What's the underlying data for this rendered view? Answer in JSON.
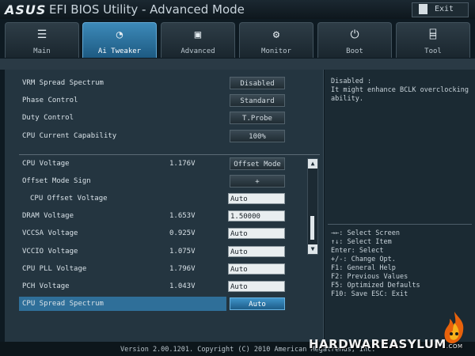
{
  "header": {
    "logo": "ASUS",
    "title": "EFI BIOS Utility - Advanced Mode",
    "exit_label": "Exit"
  },
  "tabs": [
    {
      "label": "Main",
      "icon": "list-icon"
    },
    {
      "label": "Ai Tweaker",
      "icon": "tweaker-icon",
      "active": true
    },
    {
      "label": "Advanced",
      "icon": "advanced-icon"
    },
    {
      "label": "Monitor",
      "icon": "monitor-icon"
    },
    {
      "label": "Boot",
      "icon": "power-icon"
    },
    {
      "label": "Tool",
      "icon": "toolbox-icon"
    }
  ],
  "settings_top": [
    {
      "label": "VRM Spread Spectrum",
      "value": "Disabled"
    },
    {
      "label": "Phase Control",
      "value": "Standard"
    },
    {
      "label": "Duty Control",
      "value": "T.Probe"
    },
    {
      "label": "CPU Current Capability",
      "value": "100%"
    }
  ],
  "settings_bottom": [
    {
      "label": "CPU Voltage",
      "reading": "1.176V",
      "control": "Offset Mode"
    },
    {
      "label": "Offset Mode Sign",
      "reading": "",
      "control": "+"
    },
    {
      "label": "CPU Offset Voltage",
      "reading": "",
      "control": "Auto"
    },
    {
      "label": "DRAM Voltage",
      "reading": "1.653V",
      "control": "1.50000"
    },
    {
      "label": "VCCSA Voltage",
      "reading": "0.925V",
      "control": "Auto"
    },
    {
      "label": "VCCIO Voltage",
      "reading": "1.075V",
      "control": "Auto"
    },
    {
      "label": "CPU PLL Voltage",
      "reading": "1.796V",
      "control": "Auto"
    },
    {
      "label": "PCH Voltage",
      "reading": "1.043V",
      "control": "Auto"
    },
    {
      "label": "CPU Spread Spectrum",
      "reading": "",
      "control": "Auto",
      "selected": true
    }
  ],
  "help": {
    "lines": [
      "Disabled :",
      "It might enhance BCLK overclocking",
      "ability."
    ]
  },
  "keys": {
    "lines": [
      "→←: Select Screen",
      "↑↓: Select Item",
      "Enter: Select",
      "+/-: Change Opt.",
      "F1: General Help",
      "F2: Previous Values",
      "F5: Optimized Defaults",
      "F10: Save  ESC: Exit"
    ]
  },
  "footer": {
    "copyright": "Version 2.00.1201. Copyright (C) 2010 American Megatrends, Inc."
  },
  "watermark": {
    "text": "HARDWAREASYLUM",
    "suffix": ".COM"
  },
  "colors": {
    "accent": "#2f6f99",
    "active_tab": "#3d8ab9",
    "background": "#243540"
  }
}
